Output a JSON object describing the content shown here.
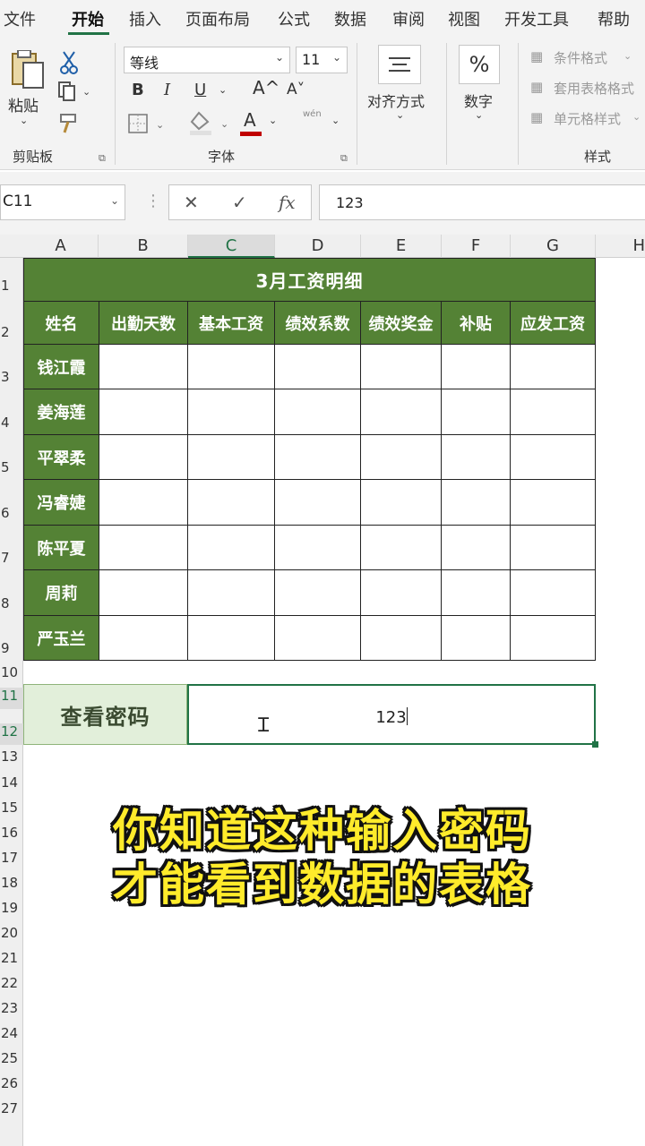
{
  "ribbon": {
    "tabs": [
      "文件",
      "开始",
      "插入",
      "页面布局",
      "公式",
      "数据",
      "审阅",
      "视图",
      "开发工具",
      "帮助"
    ],
    "clipboard": {
      "paste_label": "粘贴",
      "group_label": "剪贴板"
    },
    "font": {
      "font_name": "等线",
      "font_size": "11",
      "group_label": "字体",
      "bold": "B",
      "italic": "I",
      "underline": "U",
      "grow": "A^",
      "shrink": "A˅",
      "font_color": "A",
      "phonetic": "wén"
    },
    "alignment": {
      "label": "对齐方式"
    },
    "number": {
      "label": "数字",
      "icon_text": "%"
    },
    "styles": {
      "conditional": "条件格式",
      "table_format": "套用表格格式",
      "cell_styles": "单元格样式",
      "group_label": "样式"
    }
  },
  "formula_bar": {
    "name_box": "C11",
    "value": "123",
    "cancel": "✕",
    "enter": "✓",
    "fx": "fx"
  },
  "grid": {
    "columns": [
      "A",
      "B",
      "C",
      "D",
      "E",
      "F",
      "G",
      "H"
    ],
    "rows": [
      "1",
      "2",
      "3",
      "4",
      "5",
      "6",
      "7",
      "8",
      "9",
      "10",
      "11",
      "12",
      "13",
      "14",
      "15",
      "16",
      "17",
      "18",
      "19",
      "20",
      "21",
      "22",
      "23",
      "24",
      "25",
      "26",
      "27"
    ]
  },
  "table": {
    "title": "3月工资明细",
    "headers": [
      "姓名",
      "出勤天数",
      "基本工资",
      "绩效系数",
      "绩效奖金",
      "补贴",
      "应发工资"
    ],
    "names": [
      "钱江霞",
      "姜海莲",
      "平翠柔",
      "冯睿婕",
      "陈平夏",
      "周莉",
      "严玉兰"
    ]
  },
  "password": {
    "label": "查看密码",
    "value": "123"
  },
  "caption": {
    "line1": "你知道这种输入密码",
    "line2": "才能看到数据的表格"
  },
  "colors": {
    "accent": "#217346",
    "header_green": "#548235",
    "caption_yellow": "#ffeb2b"
  }
}
